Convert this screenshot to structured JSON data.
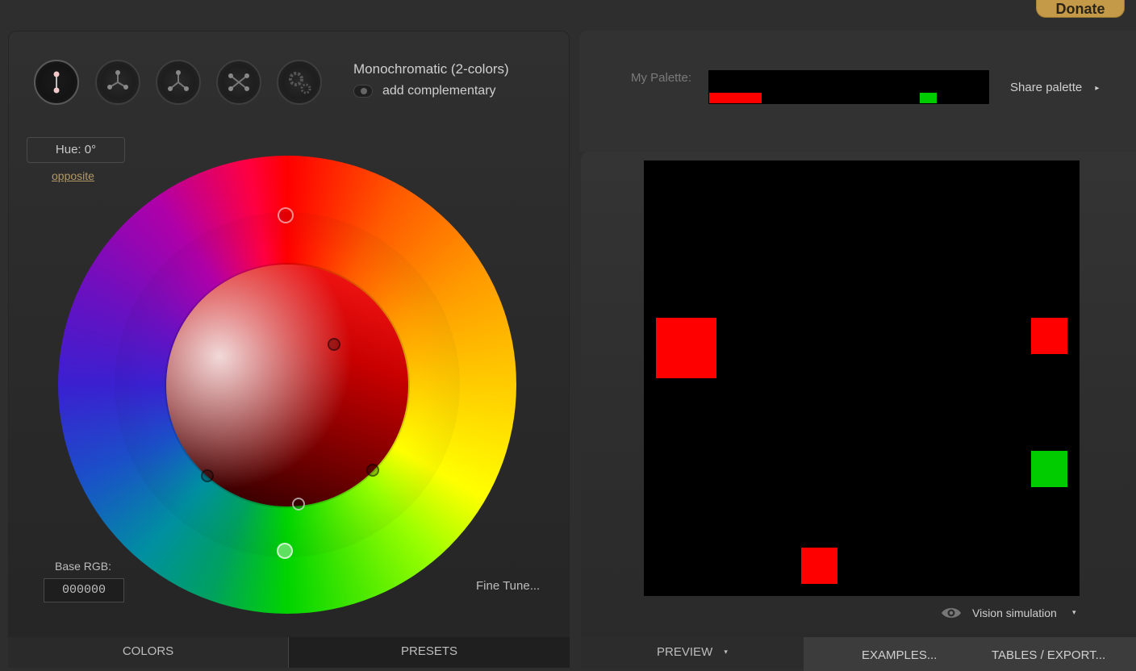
{
  "header": {
    "donate_label": "Donate"
  },
  "scheme": {
    "dials": [
      "mono",
      "complement",
      "triad",
      "tetrad",
      "freestyle"
    ],
    "name": "Monochromatic (2-colors)",
    "add_complementary_label": "add complementary",
    "add_complementary_on": false
  },
  "hue": {
    "label": "Hue: 0°",
    "opposite_label": "opposite"
  },
  "base_rgb": {
    "label": "Base RGB:",
    "value": "000000"
  },
  "fine_tune_label": "Fine Tune...",
  "left_tabs": {
    "colors": "COLORS",
    "presets": "PRESETS"
  },
  "palette": {
    "label": "My Palette:",
    "share_label": "Share palette",
    "share_arrow": "▸",
    "swatch_colors": [
      "#ff0000",
      "#00cc00"
    ]
  },
  "preview": {
    "background": "#000000",
    "swatch_colors": [
      "#ff0000",
      "#ff0000",
      "#00cc00",
      "#ff0000"
    ]
  },
  "vision": {
    "label": "Vision simulation",
    "caret": "▾",
    "icon": "eye-icon"
  },
  "right_tabs": {
    "preview": "PREVIEW",
    "preview_caret": "▾",
    "examples": "EXAMPLES...",
    "tables": "TABLES / EXPORT..."
  },
  "colors": {
    "accent": "#c49a48",
    "link": "#b09868"
  }
}
